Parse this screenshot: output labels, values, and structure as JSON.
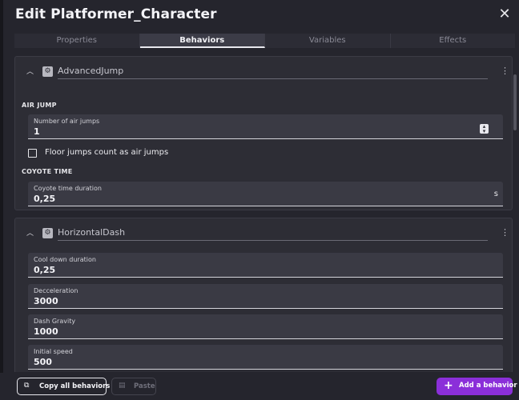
{
  "dialog": {
    "title": "Edit Platformer_Character"
  },
  "tabs": [
    {
      "label": "Properties"
    },
    {
      "label": "Behaviors"
    },
    {
      "label": "Variables"
    },
    {
      "label": "Effects"
    }
  ],
  "behaviors": [
    {
      "name": "AdvancedJump",
      "sections": {
        "air_jump": "AIR JUMP",
        "coyote_time": "COYOTE TIME"
      },
      "fields": {
        "air_jumps": {
          "label": "Number of air jumps",
          "value": "1"
        },
        "floor_jumps": {
          "label": "Floor jumps count as air jumps"
        },
        "coyote": {
          "label": "Coyote time duration",
          "value": "0,25",
          "unit": "s"
        }
      }
    },
    {
      "name": "HorizontalDash",
      "fields": [
        {
          "label": "Cool down duration",
          "value": "0,25"
        },
        {
          "label": "Decceleration",
          "value": "3000"
        },
        {
          "label": "Dash Gravity",
          "value": "1000"
        },
        {
          "label": "Initial speed",
          "value": "500"
        }
      ]
    }
  ],
  "footer": {
    "copy_label": "Copy all behaviors",
    "paste_label": "Paste",
    "add_label": "Add a behavior"
  }
}
